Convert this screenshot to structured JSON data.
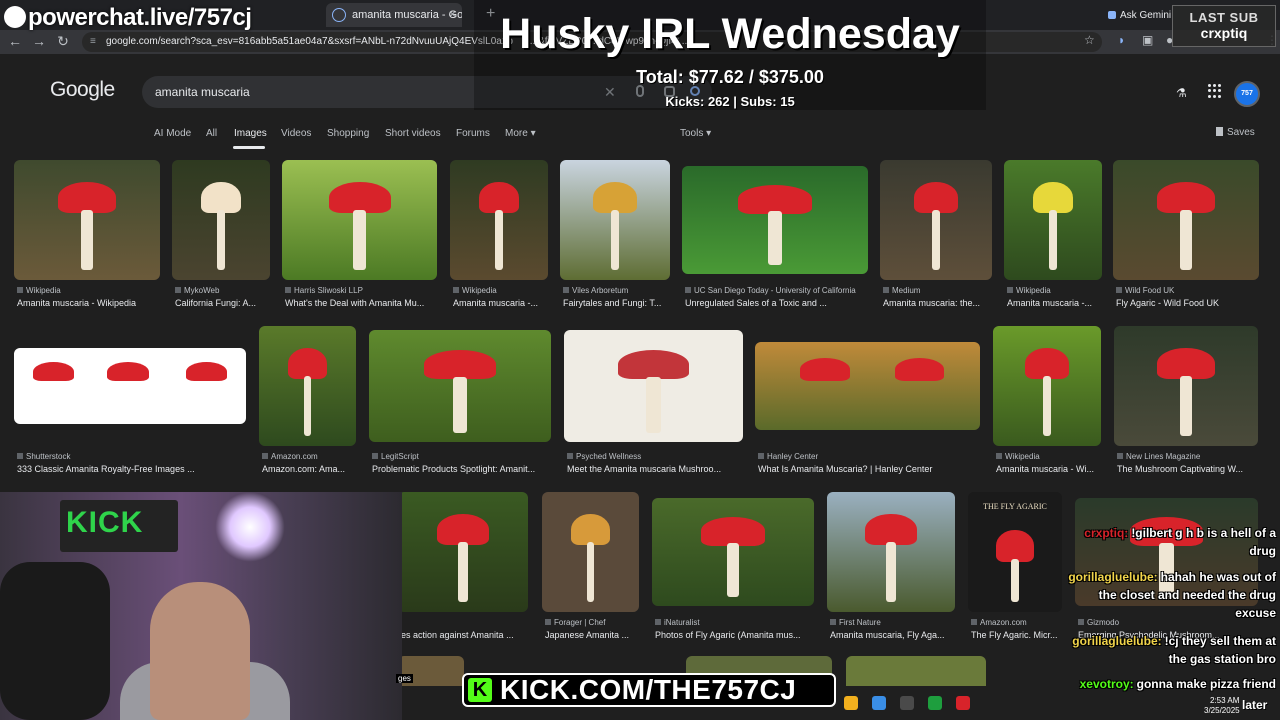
{
  "browser": {
    "tab_title": "amanita muscaria - Google Search",
    "new_tab": "+",
    "gemini_label": "Ask Gemini",
    "url": "google.com/search?sca_esv=816abb5a51ae04a7&sxsrf=ANbL-n72dNvuuUAjQ4EVslL0a1b",
    "url_tail": "...&fi=VZEB0...tdCeKlwp94h-QjI4l...",
    "icons": {
      "back": "arrow-left-icon",
      "forward": "arrow-right-icon",
      "reload": "reload-icon",
      "star": "star-icon",
      "extensions": "puzzle-icon",
      "profile": "profile-icon",
      "menu": "kebab-menu-icon"
    }
  },
  "google": {
    "logo": "Google",
    "query": "amanita muscaria",
    "tabs": [
      "AI Mode",
      "All",
      "Images",
      "Videos",
      "Shopping",
      "Short videos",
      "Forums",
      "More"
    ],
    "active_tab": "Images",
    "tools": "Tools",
    "saves": "Saves",
    "avatar_text": "757"
  },
  "results": [
    {
      "source": "Wikipedia",
      "title": "Amanita muscaria - Wikipedia"
    },
    {
      "source": "MykoWeb",
      "title": "California Fungi: A..."
    },
    {
      "source": "Harris Sliwoski LLP",
      "title": "What's the Deal with Amanita Mu..."
    },
    {
      "source": "Wikipedia",
      "title": "Amanita muscaria -..."
    },
    {
      "source": "Viles Arboretum",
      "title": "Fairytales and Fungi: T..."
    },
    {
      "source": "UC San Diego Today - University of California",
      "title": "Unregulated Sales of a Toxic and ..."
    },
    {
      "source": "Medium",
      "title": "Amanita muscaria: the..."
    },
    {
      "source": "Wikipedia",
      "title": "Amanita muscaria -..."
    },
    {
      "source": "Wild Food UK",
      "title": "Fly Agaric - Wild Food UK"
    },
    {
      "source": "Shutterstock",
      "title": "333 Classic Amanita Royalty-Free Images ..."
    },
    {
      "source": "Amazon.com",
      "title": "Amazon.com: Ama..."
    },
    {
      "source": "LegitScript",
      "title": "Problematic Products Spotlight: Amanit..."
    },
    {
      "source": "Psyched Wellness",
      "title": "Meet the Amanita muscaria Mushroo..."
    },
    {
      "source": "Hanley Center",
      "title": "What Is Amanita Muscaria? | Hanley Center"
    },
    {
      "source": "Wikipedia",
      "title": "Amanita muscaria - Wi..."
    },
    {
      "source": "New Lines Magazine",
      "title": "The Mushroom Captivating W..."
    },
    {
      "source": "",
      "title": "es action against Amanita ..."
    },
    {
      "source": "Forager | Chef",
      "title": "Japanese Amanita ..."
    },
    {
      "source": "iNaturalist",
      "title": "Photos of Fly Agaric (Amanita mus..."
    },
    {
      "source": "First Nature",
      "title": "Amanita muscaria, Fly Aga..."
    },
    {
      "source": "Amazon.com",
      "title": "The Fly Agaric. Micr..."
    },
    {
      "source": "Gizmodo",
      "title": "Emerging Psychedelic Mushroom..."
    }
  ],
  "image_text": {
    "fly_agaric_book": "THE FLY AGARIC"
  },
  "overlay": {
    "brand": "powerchat.live/757cj",
    "goal_title": "Husky IRL Wednesday",
    "goal_total": "Total: $77.62 / $375.00",
    "goal_stats": "Kicks: 262 | Subs: 15",
    "last_sub_label": "LAST SUB",
    "last_sub_name": "crxptiq",
    "kick_banner": "KICK.COM/THE757CJ",
    "webcam_sign": "KICK",
    "webcam_label": "ges"
  },
  "chat": [
    {
      "user": "crxptiq:",
      "text": "!gilbert g h b is a hell of a drug",
      "color": "#d8232a"
    },
    {
      "user": "gorillagluelube:",
      "text": "hahah he was out of the closet and needed the drug excuse",
      "color": "#f1d44b"
    },
    {
      "user": "gorillagluelube:",
      "text": "!cj they sell them at the gas station bro",
      "color": "#f1d44b"
    },
    {
      "user": "xevotroy:",
      "text": "gonna make pizza friend",
      "color": "#53fc18"
    }
  ],
  "taskbar": {
    "time": "2:53 AM",
    "date": "3/25/2025",
    "later": "later"
  },
  "colors": {
    "bg": "#1f1f1f",
    "chip": "#303134",
    "accent": "#8ab4f8",
    "kick_green": "#53fc18"
  }
}
